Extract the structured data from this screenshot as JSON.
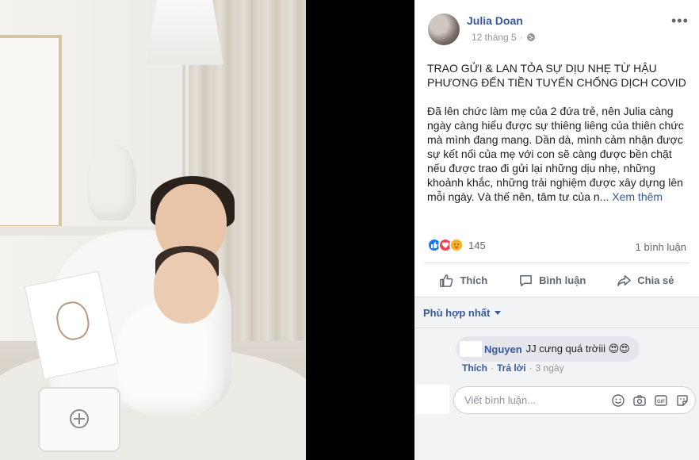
{
  "post": {
    "author": "Julia Doan",
    "date": "12 tháng 5",
    "more_icon": "•••",
    "title": "TRAO GỬI & LAN TỎA SỰ DỊU NHẸ TỪ HẬU PHƯƠNG ĐẾN TIỀN TUYẾN CHỐNG DỊCH COVID",
    "body": "Đã lên chức làm mẹ của 2 đứa trẻ, nên Julia càng ngày càng hiểu được sự thiêng liêng của thiên chức mà mình đang mang. Dần dà, mình cảm nhận được sự kết nối của mẹ với con sẽ càng được bền chặt nếu được trao đi gửi lại những dịu nhẹ, những khoảnh khắc, những trải nghiệm được xây dựng lên mỗi ngày. Và thế nên, tâm tư của n...",
    "see_more": "Xem thêm"
  },
  "stats": {
    "reaction_count": "145",
    "comment_count": "1 bình luận",
    "reaction_icons": [
      "like-icon",
      "love-icon",
      "care-icon"
    ]
  },
  "actions": {
    "like": "Thích",
    "comment": "Bình luận",
    "share": "Chia sẻ"
  },
  "comments": {
    "sort_label": "Phù hợp nhất",
    "items": [
      {
        "name": "Nguyen",
        "text": "JJ cưng quá trờiii 😍😍",
        "like": "Thích",
        "reply": "Trả lời",
        "time": "3 ngày"
      }
    ]
  },
  "composer": {
    "placeholder": "Viết bình luận...",
    "icons": [
      "emoji-icon",
      "camera-icon",
      "gif-icon",
      "sticker-icon"
    ]
  },
  "colors": {
    "link": "#385898",
    "like": "#1877f2",
    "love": "#f33e58",
    "care": "#f7b125",
    "muted": "#606770"
  }
}
